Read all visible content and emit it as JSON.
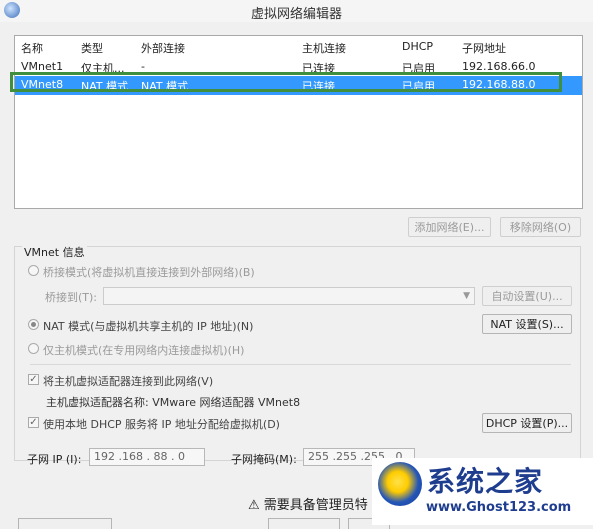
{
  "window": {
    "title": "虚拟网络编辑器"
  },
  "table": {
    "headers": [
      "名称",
      "类型",
      "外部连接",
      "主机连接",
      "DHCP",
      "子网地址"
    ],
    "rows": [
      [
        "VMnet1",
        "仅主机...",
        "-",
        "已连接",
        "已启用",
        "192.168.66.0"
      ],
      [
        "VMnet8",
        "NAT 模式",
        "NAT 模式",
        "已连接",
        "已启用",
        "192.168.88.0"
      ]
    ]
  },
  "list_buttons": {
    "add": "添加网络(E)...",
    "remove": "移除网络(O)"
  },
  "vmnet_info": {
    "group_label": "VMnet 信息",
    "bridge_radio": "桥接模式(将虚拟机直接连接到外部网络)(B)",
    "bridge_to_label": "桥接到(T):",
    "auto_settings": "自动设置(U)...",
    "nat_radio": "NAT 模式(与虚拟机共享主机的 IP 地址)(N)",
    "nat_settings": "NAT 设置(S)...",
    "hostonly_radio": "仅主机模式(在专用网络内连接虚拟机)(H)",
    "connect_adapter_check": "将主机虚拟适配器连接到此网络(V)",
    "adapter_name": "主机虚拟适配器名称: VMware 网络适配器 VMnet8",
    "dhcp_check": "使用本地 DHCP 服务将 IP 地址分配给虚拟机(D)",
    "dhcp_settings": "DHCP 设置(P)...",
    "subnet_ip_label": "子网 IP (I):",
    "subnet_ip_value": "192 .168 . 88 .  0",
    "subnet_mask_label": "子网掩码(M):",
    "subnet_mask_value": "255 .255 .255 .  0"
  },
  "footer": {
    "warning": "需要具备管理员特"
  },
  "watermark": {
    "cn": "系统之家",
    "url": "www.Ghost123.com"
  }
}
